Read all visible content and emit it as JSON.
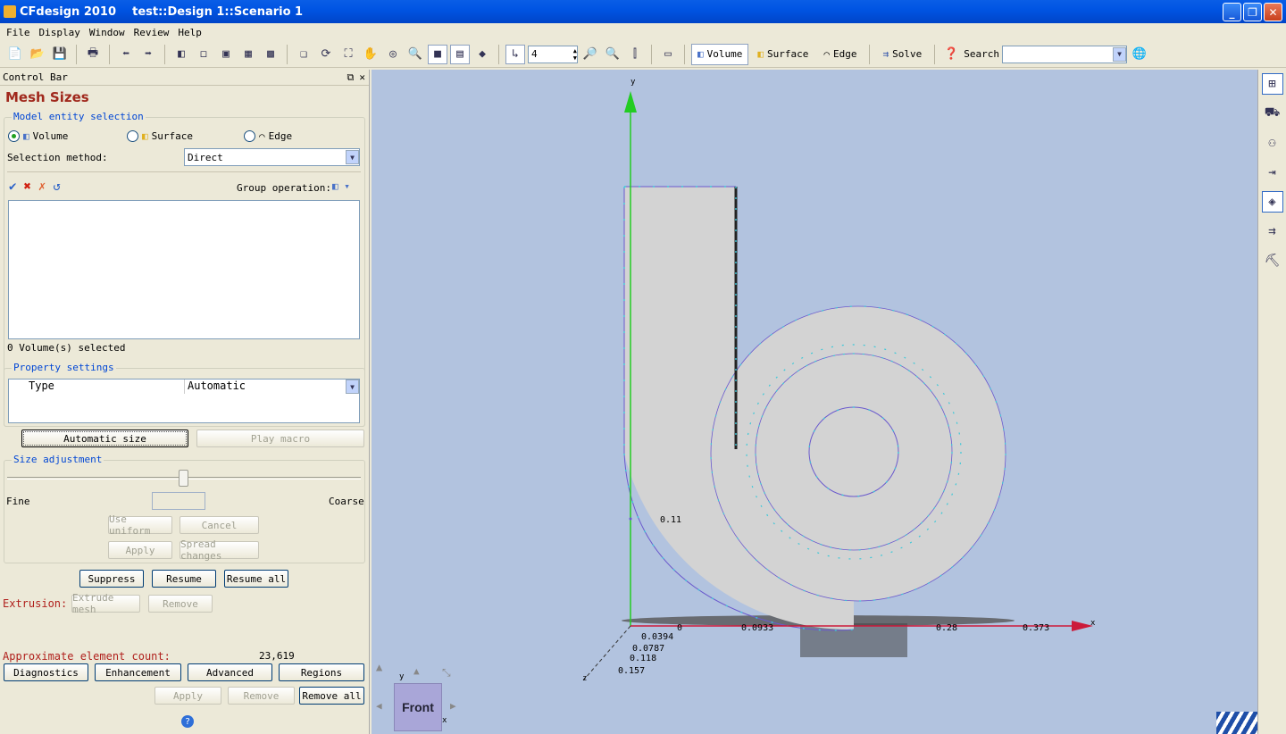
{
  "window": {
    "title": "CFdesign 2010    test::Design 1::Scenario 1",
    "btn_min": "_",
    "btn_max": "❐",
    "btn_close": "✕"
  },
  "menu": [
    "File",
    "Display",
    "Window",
    "Review",
    "Help"
  ],
  "toolbar": {
    "spin_value": "4",
    "volume_label": "Volume",
    "surface_label": "Surface",
    "edge_label": "Edge",
    "solve_label": "Solve",
    "search_label": "Search",
    "search_value": ""
  },
  "control_bar": {
    "header": "Control Bar",
    "title": "Mesh Sizes",
    "model_entity_label": "Model entity selection",
    "radio_volume": "Volume",
    "radio_surface": "Surface",
    "radio_edge": "Edge",
    "selection_method_label": "Selection method:",
    "selection_method_value": "Direct",
    "group_operation_label": "Group operation:",
    "selected_status": "0 Volume(s) selected",
    "property_settings_label": "Property settings",
    "prop_type_label": "Type",
    "prop_type_value": "Automatic",
    "automatic_size": "Automatic size",
    "play_macro": "Play macro",
    "size_adjustment_label": "Size adjustment",
    "fine_label": "Fine",
    "coarse_label": "Coarse",
    "slider_position": 0.5,
    "size_value": "",
    "use_uniform": "Use uniform",
    "cancel": "Cancel",
    "apply": "Apply",
    "spread_changes": "Spread changes",
    "suppress": "Suppress",
    "resume": "Resume",
    "resume_all": "Resume all",
    "extrusion_label": "Extrusion:",
    "extrude_mesh": "Extrude mesh",
    "remove": "Remove",
    "element_count_label": "Approximate element count:",
    "element_count_value": "23,619",
    "diagnostics": "Diagnostics",
    "enhancement": "Enhancement",
    "advanced": "Advanced",
    "regions": "Regions",
    "apply2": "Apply",
    "remove2": "Remove",
    "remove_all": "Remove all"
  },
  "viewport": {
    "axis_y": "y",
    "axis_x": "x",
    "axis_z": "z",
    "x_ticks": [
      "0",
      "0.0933",
      "0.28",
      "0.373"
    ],
    "z_ticks": [
      "0.0394",
      "0.0787",
      "0.118",
      "0.157"
    ],
    "y_tick": "0.11",
    "view_cube": "Front",
    "cube_y": "y",
    "cube_x": "x"
  }
}
